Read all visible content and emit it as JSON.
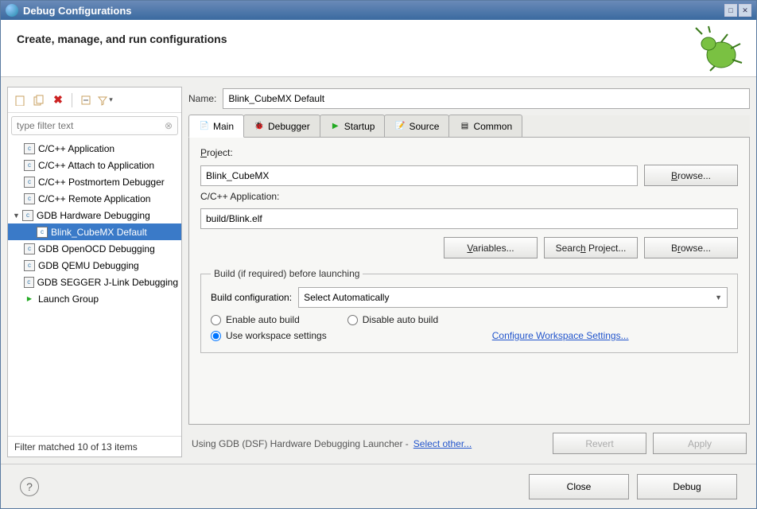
{
  "window": {
    "title": "Debug Configurations"
  },
  "header": {
    "subtitle": "Create, manage, and run configurations"
  },
  "filter": {
    "placeholder": "type filter text"
  },
  "tree": {
    "items": [
      {
        "label": "C/C++ Application",
        "icon": "c"
      },
      {
        "label": "C/C++ Attach to Application",
        "icon": "c"
      },
      {
        "label": "C/C++ Postmortem Debugger",
        "icon": "c"
      },
      {
        "label": "C/C++ Remote Application",
        "icon": "c"
      },
      {
        "label": "GDB Hardware Debugging",
        "icon": "c",
        "expanded": true,
        "children": [
          {
            "label": "Blink_CubeMX Default",
            "icon": "c",
            "selected": true
          }
        ]
      },
      {
        "label": "GDB OpenOCD Debugging",
        "icon": "c"
      },
      {
        "label": "GDB QEMU Debugging",
        "icon": "c"
      },
      {
        "label": "GDB SEGGER J-Link Debugging",
        "icon": "c"
      },
      {
        "label": "Launch Group",
        "icon": "launch"
      }
    ],
    "status": "Filter matched 10 of 13 items"
  },
  "form": {
    "name_label": "Name:",
    "name_value": "Blink_CubeMX Default",
    "tabs": [
      "Main",
      "Debugger",
      "Startup",
      "Source",
      "Common"
    ],
    "active_tab": 0,
    "project_label": "Project:",
    "project_value": "Blink_CubeMX",
    "project_browse": "Browse...",
    "app_label": "C/C++ Application:",
    "app_value": "build/Blink.elf",
    "btn_variables": "Variables...",
    "btn_search": "Search Project...",
    "btn_browse2": "Browse...",
    "build_legend": "Build (if required) before launching",
    "build_cfg_label": "Build configuration:",
    "build_cfg_value": "Select Automatically",
    "radio_enable": "Enable auto build",
    "radio_disable": "Disable auto build",
    "radio_workspace": "Use workspace settings",
    "link_cfg_ws": "Configure Workspace Settings...",
    "launcher_text": "Using GDB (DSF) Hardware Debugging Launcher - ",
    "link_select_other": "Select other...",
    "btn_revert": "Revert",
    "btn_apply": "Apply"
  },
  "footer": {
    "btn_close": "Close",
    "btn_debug": "Debug"
  }
}
